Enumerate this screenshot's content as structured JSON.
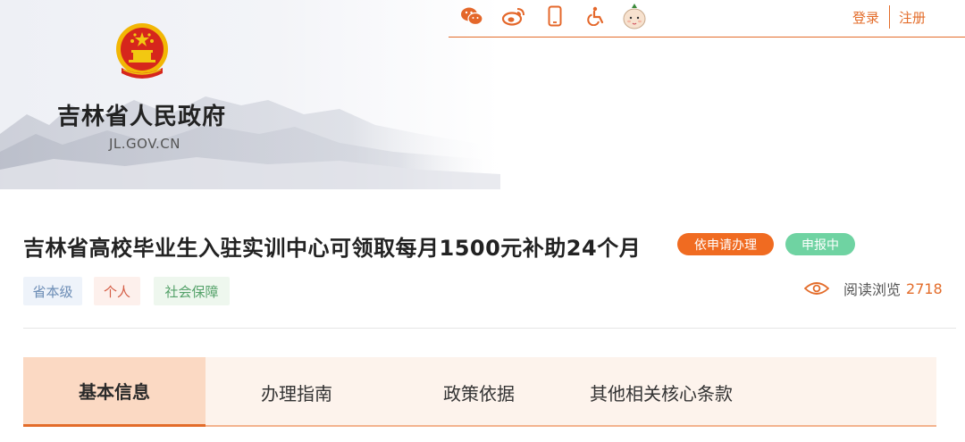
{
  "header": {
    "site_title": "吉林省人民政府",
    "site_domain": "JL.GOV.CN",
    "login_label": "登录",
    "register_label": "注册",
    "tool_icons": [
      "wechat-icon",
      "weibo-icon",
      "mobile-icon",
      "accessibility-icon",
      "mascot-icon"
    ]
  },
  "article": {
    "title": "吉林省高校毕业生入驻实训中心可领取每月1500元补助24个月",
    "badge_apply": "依申请办理",
    "badge_status": "申报中",
    "tags": [
      "省本级",
      "个人",
      "社会保障"
    ],
    "views_label": "阅读浏览",
    "views_count": "2718"
  },
  "tabs": [
    {
      "label": "基本信息",
      "active": true
    },
    {
      "label": "办理指南",
      "active": false
    },
    {
      "label": "政策依据",
      "active": false
    },
    {
      "label": "其他相关核心条款",
      "active": false
    }
  ],
  "colors": {
    "accent": "#e36c2a",
    "badge_apply": "#f06b21",
    "badge_status": "#6fd3a2",
    "tab_active_bg": "#fbd9c3",
    "tab_bg": "#fdf3ec"
  }
}
